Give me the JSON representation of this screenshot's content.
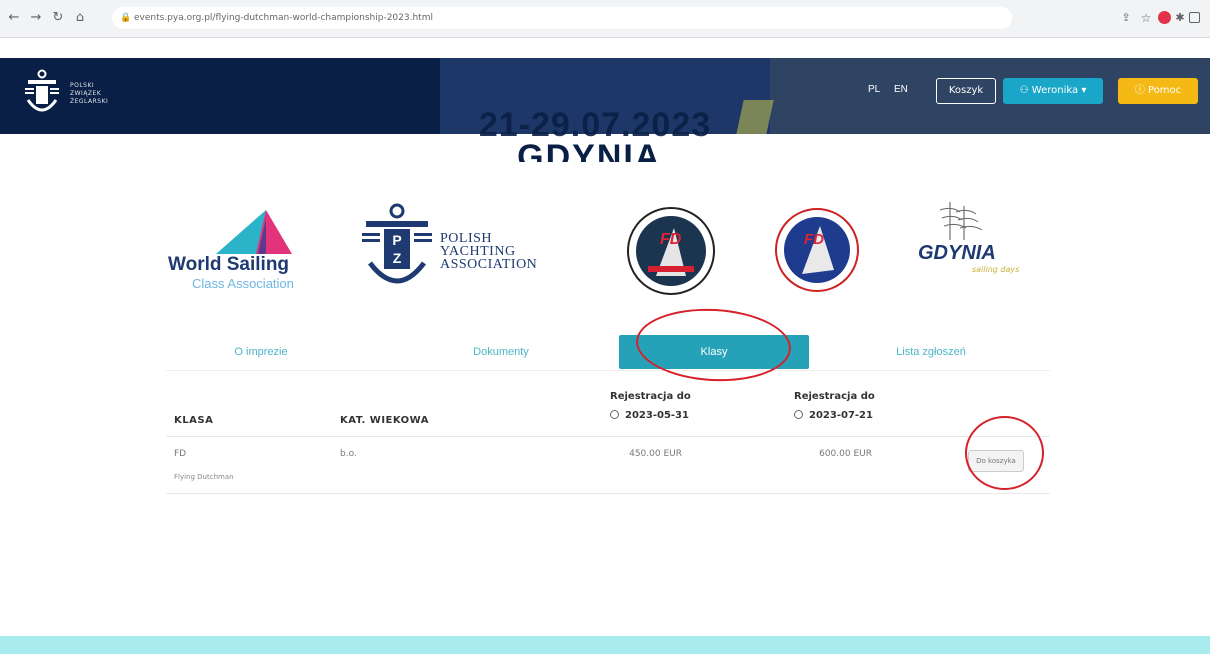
{
  "browser": {
    "url": "events.pya.org.pl/flying-dutchman-world-championship-2023.html"
  },
  "header": {
    "org_name_line1": "POLSKI",
    "org_name_line2": "ZWIĄZEK",
    "org_name_line3": "ŻEGLARSKI",
    "lang_pl": "PL",
    "lang_en": "EN",
    "cart_label": "Koszyk",
    "user_label": "Weronika",
    "help_label": "Pomoc"
  },
  "banner": {
    "dates": "21-29.07.2023",
    "city": "GDYNIA, POLAND"
  },
  "logos": {
    "world_sailing_title": "World Sailing",
    "world_sailing_sub": "Class Association",
    "pya_line1": "POLISH",
    "pya_line2": "YACHTING",
    "pya_line3": "ASSOCIATION",
    "gdynia_title": "GDYNIA",
    "gdynia_sub": "sailing days"
  },
  "tabs": [
    {
      "label": "O imprezie"
    },
    {
      "label": "Dokumenty"
    },
    {
      "label": "Klasy"
    },
    {
      "label": "Lista zgłoszeń"
    }
  ],
  "table": {
    "col_class": "KLASA",
    "col_age": "KAT. WIEKOWA",
    "col_reg1_label": "Rejestracja do",
    "col_reg1_date": "2023-05-31",
    "col_reg2_label": "Rejestracja do",
    "col_reg2_date": "2023-07-21",
    "rows": [
      {
        "class": "FD",
        "class_full": "Flying Dutchman",
        "age": "b.o.",
        "price1": "450.00 EUR",
        "price2": "600.00 EUR",
        "action": "Do koszyka"
      }
    ]
  },
  "colors": {
    "header_navy": "#0c2650",
    "tab_active": "#26a2b8",
    "user_button": "#1aa6c8",
    "help_button": "#f5b915",
    "annotation_red": "#d6202a",
    "footer": "#a8ecef"
  },
  "icons": {
    "lock": "lock-icon",
    "user": "user-icon",
    "help": "help-circle-icon",
    "clock": "clock-icon",
    "caret": "caret-down-icon"
  }
}
